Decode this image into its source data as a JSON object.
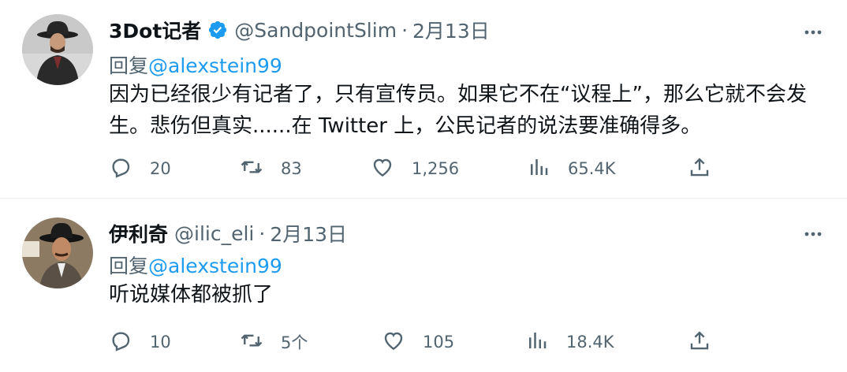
{
  "tweets": [
    {
      "author_name": "3Dot记者",
      "verified": true,
      "handle": "@SandpointSlim",
      "separator": "·",
      "date": "2月13日",
      "reply_label": "回复",
      "reply_mention": "@alexstein99",
      "text": "因为已经很少有记者了，只有宣传员。如果它不在“议程上”，那么它就不会发生。悲伤但真实......在 Twitter 上，公民记者的说法要准确得多。",
      "replies": "20",
      "retweets": "83",
      "likes": "1,256",
      "views": "65.4K"
    },
    {
      "author_name": "伊利奇",
      "verified": false,
      "handle": "@ilic_eli",
      "separator": "·",
      "date": "2月13日",
      "reply_label": "回复",
      "reply_mention": "@alexstein99",
      "text": "听说媒体都被抓了",
      "replies": "10",
      "retweets": "5个",
      "likes": "105",
      "views": "18.4K"
    }
  ],
  "icons": {
    "reply": "reply-icon",
    "retweet": "retweet-icon",
    "like": "heart-icon",
    "views": "views-icon",
    "share": "share-icon",
    "more": "more-icon",
    "verified": "verified-badge-icon"
  },
  "colors": {
    "text_primary": "#0f1419",
    "text_secondary": "#536471",
    "link": "#1d9bf0",
    "divider": "#eff3f4"
  }
}
